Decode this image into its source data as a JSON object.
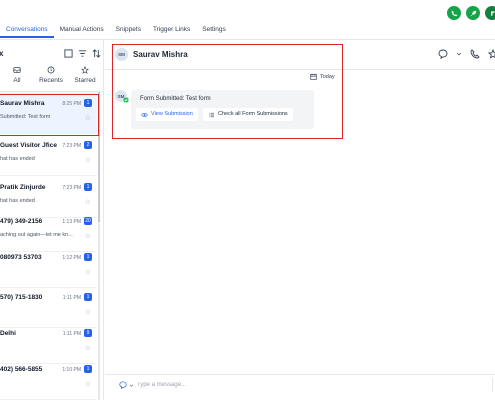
{
  "header": {
    "tabs": [
      {
        "label": "Conversations",
        "active": true
      },
      {
        "label": "Manual Actions",
        "active": false
      },
      {
        "label": "Snippets",
        "active": false
      },
      {
        "label": "Trigger Links",
        "active": false
      },
      {
        "label": "Settings",
        "active": false
      }
    ],
    "right_icons": [
      {
        "icon": "phone-icon",
        "color": "#16a34a"
      },
      {
        "icon": "rocket-icon",
        "color": "#16a34a"
      },
      {
        "icon": "notification-icon",
        "color": "#15803d"
      }
    ]
  },
  "inbox": {
    "title": "x",
    "head_icons": [
      "select-checkbox-icon",
      "filter-icon",
      "sort-icon"
    ],
    "filters": [
      {
        "label": "All",
        "icon": "inbox-icon"
      },
      {
        "label": "Recents",
        "icon": "clock-icon"
      },
      {
        "label": "Starred",
        "icon": "star-icon"
      }
    ],
    "conversations": [
      {
        "name": "Saurav Mishra",
        "time": "8:25 PM",
        "badge": "1",
        "preview": "Submitted: Test form",
        "selected": true
      },
      {
        "name": "Guest Visitor Jfice",
        "time": "7:23 PM",
        "badge": "2",
        "preview": "hat has ended",
        "selected": false
      },
      {
        "name": "Pratik Zinjurde",
        "time": "7:23 PM",
        "badge": "1",
        "preview": "hat has ended",
        "selected": false
      },
      {
        "name": "479) 349-2156",
        "time": "1:13 PM",
        "badge": "20",
        "preview": "aching out again—let me kn...",
        "selected": false
      },
      {
        "name": "080973 53703",
        "time": "1:12 PM",
        "badge": "1",
        "preview": "",
        "selected": false
      },
      {
        "name": "570) 715-1830",
        "time": "1:11 PM",
        "badge": "1",
        "preview": "",
        "selected": false
      },
      {
        "name": "Delhi",
        "time": "1:11 PM",
        "badge": "9",
        "preview": "",
        "selected": false
      },
      {
        "name": "402) 566-5855",
        "time": "1:10 PM",
        "badge": "1",
        "preview": "",
        "selected": false
      }
    ]
  },
  "conversation": {
    "contact": {
      "initials": "SM",
      "name": "Saurav Mishra"
    },
    "date_label": "Today",
    "message": {
      "avatar_initials": "SM",
      "text": "Form Submitted: Test form",
      "primary_button": "View Submission",
      "secondary_button": "Check all Form Submissions"
    },
    "composer": {
      "placeholder": "Type a message..."
    }
  },
  "colors": {
    "accent": "#2563eb",
    "highlight": "#dc2626",
    "selected_row": "#eef4ff"
  }
}
